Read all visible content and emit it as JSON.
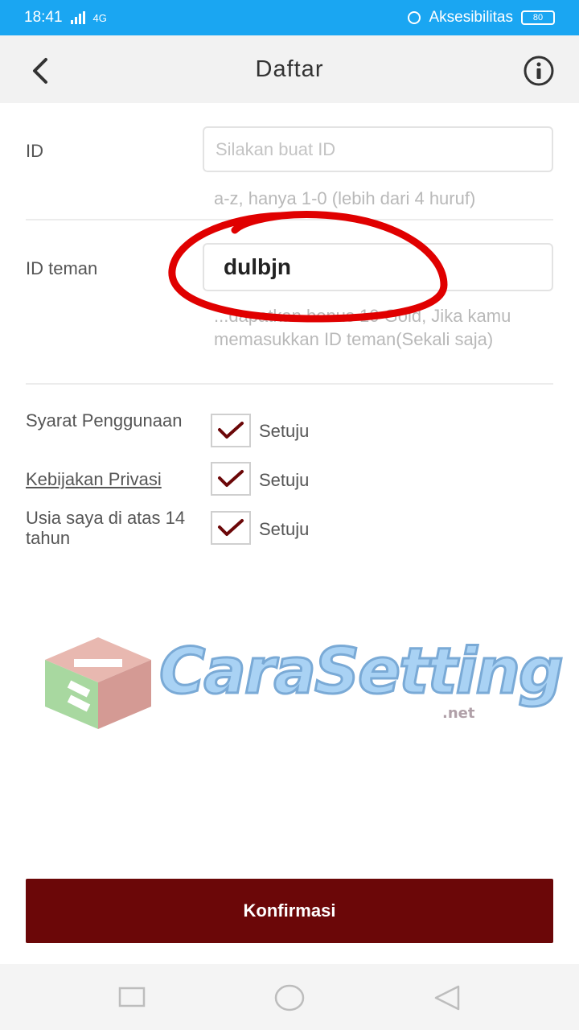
{
  "status_bar": {
    "time": "18:41",
    "network": "4G",
    "accessibility": "Aksesibilitas",
    "battery": "80"
  },
  "app_bar": {
    "title": "Daftar",
    "back_icon": "chevron-left-icon",
    "info_icon": "info-icon"
  },
  "form": {
    "id_field": {
      "label": "ID",
      "placeholder": "Silakan buat ID",
      "value": "",
      "hint": "a-z, hanya 1-0 (lebih dari 4 huruf)"
    },
    "friend_id_field": {
      "label": "ID teman",
      "value": "dulbjn",
      "hint": "...dapatkan bonus 10 Gold, Jika kamu memasukkan ID teman(Sekali saja)"
    }
  },
  "agreements": [
    {
      "label": "Syarat Penggunaan",
      "checked": true,
      "text": "Setuju"
    },
    {
      "label": "Kebijakan Privasi",
      "checked": true,
      "text": "Setuju"
    },
    {
      "label": "Usia saya di atas 14 tahun",
      "checked": true,
      "text": "Setuju"
    }
  ],
  "watermark": {
    "text": "CaraSetting",
    "sub": ".net"
  },
  "confirm_button": {
    "label": "Konfirmasi"
  },
  "colors": {
    "status_bar": "#1aa6f2",
    "primary": "#6b0708",
    "checkmark": "#6b0708",
    "annotation": "#e00000"
  }
}
